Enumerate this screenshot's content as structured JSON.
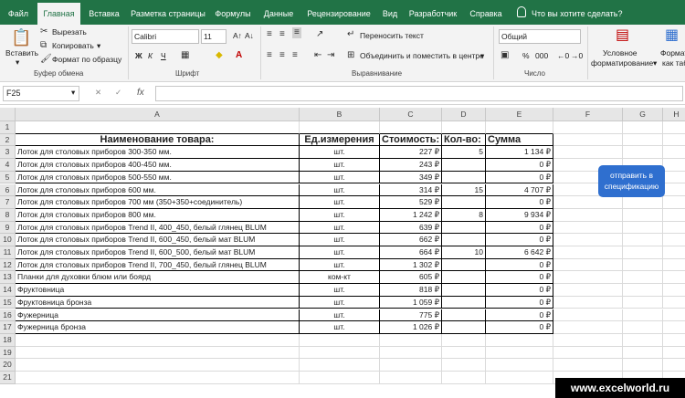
{
  "tabs": [
    "Файл",
    "Главная",
    "Вставка",
    "Разметка страницы",
    "Формулы",
    "Данные",
    "Рецензирование",
    "Вид",
    "Разработчик",
    "Справка"
  ],
  "search_text": "Что вы хотите сделать?",
  "clipboard": {
    "paste": "Вставить",
    "cut": "Вырезать",
    "copy": "Копировать",
    "format_painter": "Формат по образцу",
    "group": "Буфер обмена"
  },
  "font": {
    "name": "Calibri",
    "size": "11",
    "group": "Шрифт",
    "bold": "Ж",
    "italic": "К",
    "underline": "Ч",
    "grow": "A↑",
    "shrink": "A↓"
  },
  "alignment": {
    "wrap": "Переносить текст",
    "merge": "Объединить и поместить в центре",
    "group": "Выравнивание"
  },
  "number": {
    "format": "Общий",
    "group": "Число",
    "percent": "%",
    "thousands": "000"
  },
  "styles": {
    "conditional_line1": "Условное",
    "conditional_line2": "форматирование",
    "format_table": "Формат",
    "format_table2": "как таб"
  },
  "name_box": "F25",
  "fx": "fx",
  "columns": [
    "A",
    "B",
    "C",
    "D",
    "E",
    "F",
    "G",
    "H"
  ],
  "rows": [
    "1",
    "2",
    "3",
    "4",
    "5",
    "6",
    "7",
    "8",
    "9",
    "10",
    "11",
    "12",
    "13",
    "14",
    "15",
    "16",
    "17",
    "18",
    "19",
    "20",
    "21"
  ],
  "table": {
    "headers": [
      "Наименование товара:",
      "Ед.измерения",
      "Стоимость:",
      "Кол-во:",
      "Сумма"
    ],
    "rows": [
      [
        "Лоток для столовых приборов 300-350 мм.",
        "шт.",
        "227 ₽",
        "5",
        "1 134 ₽"
      ],
      [
        "Лоток для столовых приборов 400-450 мм.",
        "шт.",
        "243 ₽",
        "",
        "0 ₽"
      ],
      [
        "Лоток для столовых приборов 500-550 мм.",
        "шт.",
        "349 ₽",
        "",
        "0 ₽"
      ],
      [
        "Лоток для столовых приборов 600 мм.",
        "шт.",
        "314 ₽",
        "15",
        "4 707 ₽"
      ],
      [
        "Лоток для столовых приборов 700 мм (350+350+соединитель)",
        "шт.",
        "529 ₽",
        "",
        "0 ₽"
      ],
      [
        "Лоток для столовых приборов 800 мм.",
        "шт.",
        "1 242 ₽",
        "8",
        "9 934 ₽"
      ],
      [
        "Лоток для столовых приборов Trend II, 400_450, белый глянец BLUM",
        "шт.",
        "639 ₽",
        "",
        "0 ₽"
      ],
      [
        "Лоток для столовых приборов Trend II, 600_450, белый мат  BLUM",
        "шт.",
        "662 ₽",
        "",
        "0 ₽"
      ],
      [
        "Лоток для столовых приборов Trend II, 600_500, белый мат  BLUM",
        "шт.",
        "664 ₽",
        "10",
        "6 642 ₽"
      ],
      [
        "Лоток для столовых приборов Trend II, 700_450, белый глянец  BLUM",
        "шт.",
        "1 302 ₽",
        "",
        "0 ₽"
      ],
      [
        "Планки для духовки блюм или боярд",
        "ком-кт",
        "605 ₽",
        "",
        "0 ₽"
      ],
      [
        "Фруктовница",
        "шт.",
        "818 ₽",
        "",
        "0 ₽"
      ],
      [
        "Фруктовница бронза",
        "шт.",
        "1 059 ₽",
        "",
        "0 ₽"
      ],
      [
        "Фужерница",
        "шт.",
        "775 ₽",
        "",
        "0 ₽"
      ],
      [
        "Фужерница бронза",
        "шт.",
        "1 026 ₽",
        "",
        "0 ₽"
      ]
    ]
  },
  "spec_button": "отправить в спецификацию",
  "watermark": "www.excelworld.ru"
}
